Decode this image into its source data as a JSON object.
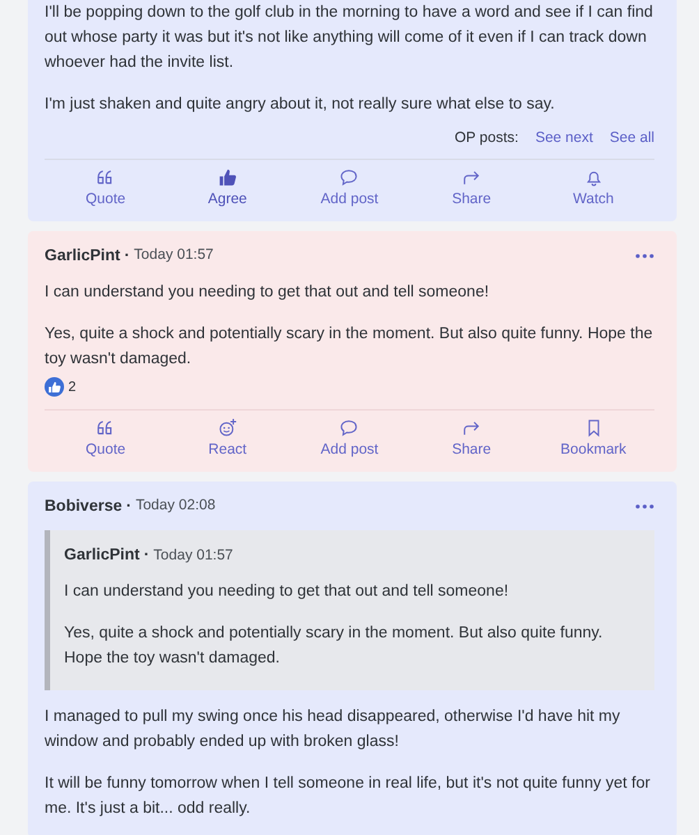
{
  "posts": [
    {
      "kind": "op",
      "paragraphs": [
        "I'll be popping down to the golf club in the morning to have a word and see if I can find out whose party it was but it's not like anything will come of it even if I can track down whoever had the invite list.",
        "I'm just shaken and quite angry about it, not really sure what else to say."
      ],
      "op_posts": {
        "label": "OP posts:",
        "links": [
          "See next",
          "See all"
        ]
      },
      "actions": [
        {
          "label": "Quote",
          "kind": "quote",
          "selected": false
        },
        {
          "label": "Agree",
          "kind": "like",
          "selected": true
        },
        {
          "label": "Add post",
          "kind": "comment",
          "selected": false
        },
        {
          "label": "Share",
          "kind": "share",
          "selected": false
        },
        {
          "label": "Watch",
          "kind": "bell",
          "selected": false
        }
      ]
    },
    {
      "kind": "reply",
      "author": "GarlicPint",
      "separator": "·",
      "time": "Today 01:57",
      "paragraphs": [
        "I can understand you needing to get that out and tell someone!",
        "Yes, quite a shock and potentially scary in the moment. But also quite funny. Hope the toy wasn't damaged."
      ],
      "reactions": {
        "count": "2"
      },
      "actions": [
        {
          "label": "Quote",
          "kind": "quote",
          "selected": false
        },
        {
          "label": "React",
          "kind": "react",
          "selected": false
        },
        {
          "label": "Add post",
          "kind": "comment",
          "selected": false
        },
        {
          "label": "Share",
          "kind": "share",
          "selected": false
        },
        {
          "label": "Bookmark",
          "kind": "bookmark",
          "selected": false
        }
      ]
    },
    {
      "kind": "op",
      "author": "Bobiverse",
      "separator": "·",
      "time": "Today 02:08",
      "quote": {
        "author": "GarlicPint",
        "separator": "·",
        "time": "Today 01:57",
        "paragraphs": [
          "I can understand you needing to get that out and tell someone!",
          "Yes, quite a shock and potentially scary in the moment. But also quite funny. Hope the toy wasn't damaged."
        ]
      },
      "paragraphs": [
        "I managed to pull my swing once his head disappeared, otherwise I'd have hit my window and probably ended up with broken glass!",
        "It will be funny tomorrow when I tell someone in real life, but it's not quite funny yet for me. It's just a bit... odd really."
      ]
    }
  ]
}
